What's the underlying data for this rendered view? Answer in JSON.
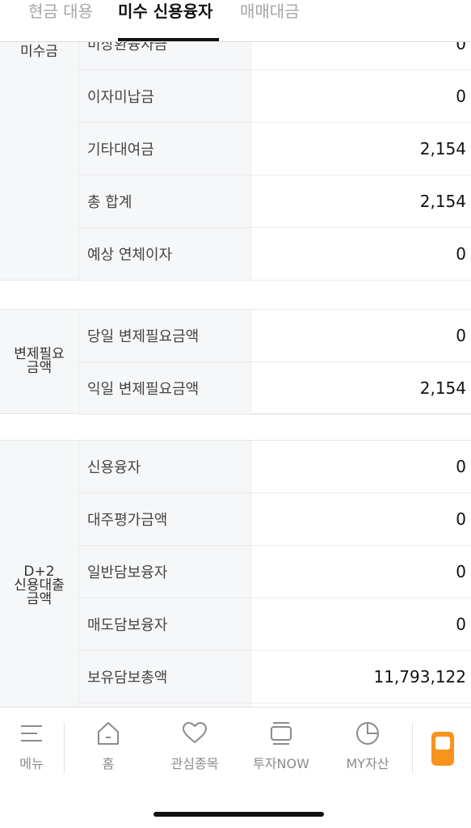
{
  "tabs": [
    {
      "label": "현금 대용"
    },
    {
      "label": "미수 신용융자"
    },
    {
      "label": "매매대금"
    }
  ],
  "group1": {
    "label": "미수금",
    "rows": [
      {
        "name": "미상환융자금",
        "value": "0"
      },
      {
        "name": "이자미납금",
        "value": "0"
      },
      {
        "name": "기타대여금",
        "value": "2,154"
      },
      {
        "name": "총 합계",
        "value": "2,154"
      },
      {
        "name": "예상 연체이자",
        "value": "0"
      }
    ]
  },
  "group2": {
    "label": "변제필요\n금액",
    "rows": [
      {
        "name": "당일 변제필요금액",
        "value": "0"
      },
      {
        "name": "익일 변제필요금액",
        "value": "2,154"
      }
    ]
  },
  "group3": {
    "label": "D+2\n신용대출\n금액",
    "rows": [
      {
        "name": "신용융자",
        "value": "0"
      },
      {
        "name": "대주평가금액",
        "value": "0"
      },
      {
        "name": "일반담보융자",
        "value": "0"
      },
      {
        "name": "매도담보융자",
        "value": "0"
      },
      {
        "name": "보유담보총액",
        "value": "11,793,122"
      }
    ]
  },
  "bottom_nav": {
    "items": [
      {
        "label": "메뉴",
        "icon": "menu-icon"
      },
      {
        "label": "홈",
        "icon": "home-icon"
      },
      {
        "label": "관심종목",
        "icon": "heart-icon"
      },
      {
        "label": "투자NOW",
        "icon": "stack-icon"
      },
      {
        "label": "MY자산",
        "icon": "pie-chart-icon"
      }
    ],
    "phone_icon": "phone-icon",
    "accent_color": "#f8941d"
  }
}
